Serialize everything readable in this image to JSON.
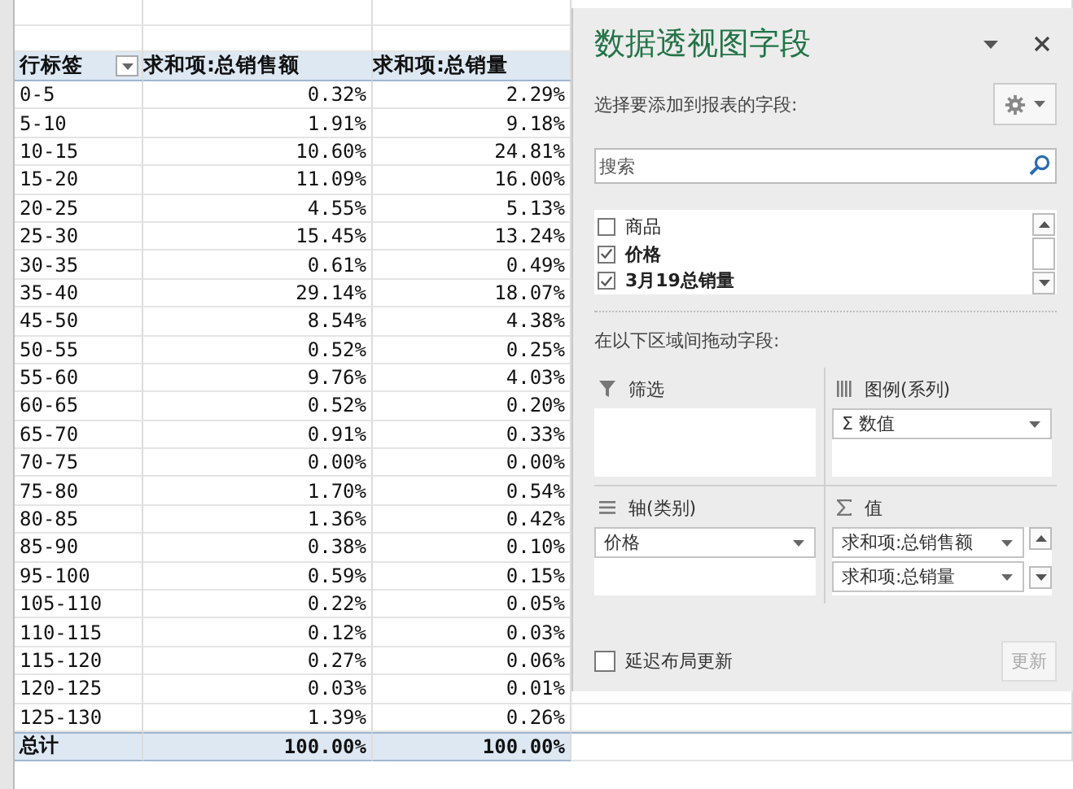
{
  "sheet": {
    "columns": [
      "行标签",
      "求和项:总销售额",
      "求和项:总销量"
    ],
    "rows": [
      {
        "label": "0-5",
        "sales": "0.32%",
        "volume": "2.29%"
      },
      {
        "label": "5-10",
        "sales": "1.91%",
        "volume": "9.18%"
      },
      {
        "label": "10-15",
        "sales": "10.60%",
        "volume": "24.81%"
      },
      {
        "label": "15-20",
        "sales": "11.09%",
        "volume": "16.00%"
      },
      {
        "label": "20-25",
        "sales": "4.55%",
        "volume": "5.13%"
      },
      {
        "label": "25-30",
        "sales": "15.45%",
        "volume": "13.24%"
      },
      {
        "label": "30-35",
        "sales": "0.61%",
        "volume": "0.49%"
      },
      {
        "label": "35-40",
        "sales": "29.14%",
        "volume": "18.07%"
      },
      {
        "label": "45-50",
        "sales": "8.54%",
        "volume": "4.38%"
      },
      {
        "label": "50-55",
        "sales": "0.52%",
        "volume": "0.25%"
      },
      {
        "label": "55-60",
        "sales": "9.76%",
        "volume": "4.03%"
      },
      {
        "label": "60-65",
        "sales": "0.52%",
        "volume": "0.20%"
      },
      {
        "label": "65-70",
        "sales": "0.91%",
        "volume": "0.33%"
      },
      {
        "label": "70-75",
        "sales": "0.00%",
        "volume": "0.00%"
      },
      {
        "label": "75-80",
        "sales": "1.70%",
        "volume": "0.54%"
      },
      {
        "label": "80-85",
        "sales": "1.36%",
        "volume": "0.42%"
      },
      {
        "label": "85-90",
        "sales": "0.38%",
        "volume": "0.10%"
      },
      {
        "label": "95-100",
        "sales": "0.59%",
        "volume": "0.15%"
      },
      {
        "label": "105-110",
        "sales": "0.22%",
        "volume": "0.05%"
      },
      {
        "label": "110-115",
        "sales": "0.12%",
        "volume": "0.03%"
      },
      {
        "label": "115-120",
        "sales": "0.27%",
        "volume": "0.06%"
      },
      {
        "label": "120-125",
        "sales": "0.03%",
        "volume": "0.01%"
      },
      {
        "label": "125-130",
        "sales": "1.39%",
        "volume": "0.26%"
      }
    ],
    "total": {
      "label": "总计",
      "sales": "100.00%",
      "volume": "100.00%"
    }
  },
  "panel": {
    "title": "数据透视图字段",
    "prompt": "选择要添加到报表的字段:",
    "search": {
      "placeholder": "搜索"
    },
    "fields": [
      {
        "label": "商品",
        "checked": false
      },
      {
        "label": "价格",
        "checked": true
      },
      {
        "label": "3月19总销量",
        "checked": true
      }
    ],
    "drag_hint": "在以下区域间拖动字段:",
    "areas": [
      {
        "kind": "filter",
        "label": "筛选"
      },
      {
        "kind": "legend",
        "label": "图例(系列)",
        "items": [
          "Σ 数值"
        ]
      },
      {
        "kind": "axis",
        "label": "轴(类别)",
        "items": [
          "价格"
        ]
      },
      {
        "kind": "values",
        "label": "值",
        "items": [
          "求和项:总销售额",
          "求和项:总销量"
        ]
      }
    ],
    "defer": {
      "label": "延迟布局更新",
      "checked": false
    },
    "update_button": {
      "label": "更新",
      "disabled": true
    }
  }
}
